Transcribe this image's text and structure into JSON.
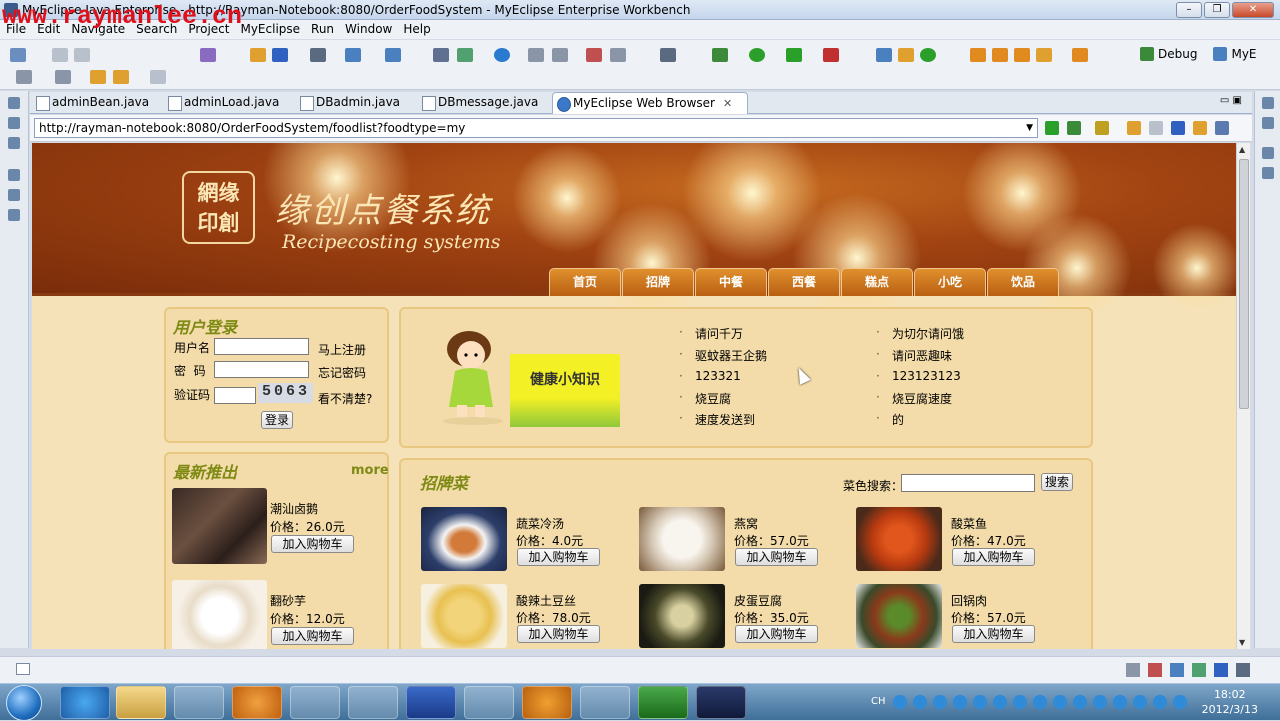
{
  "window": {
    "title": "MyEclipse Java Enterprise - http://Rayman-Notebook:8080/OrderFoodSystem - MyEclipse Enterprise Workbench",
    "watermark": "www.raymanlee.cn"
  },
  "menubar": [
    "File",
    "Edit",
    "Navigate",
    "Search",
    "Project",
    "MyEclipse",
    "Run",
    "Window",
    "Help"
  ],
  "toolbar": {
    "debug_label": "Debug",
    "perspective_label": "MyE"
  },
  "tabs": [
    {
      "label": "adminBean.java"
    },
    {
      "label": "adminLoad.java"
    },
    {
      "label": "DBadmin.java"
    },
    {
      "label": "DBmessage.java"
    },
    {
      "label": "MyEclipse Web Browser",
      "close": "✕"
    }
  ],
  "browser": {
    "url": "http://rayman-notebook:8080/OrderFoodSystem/foodlist?foodtype=my"
  },
  "site": {
    "logo_line1": "網缘",
    "logo_line2": "印創",
    "title": "缘创点餐系统",
    "subtitle": "Recipecosting systems",
    "nav": [
      "首页",
      "招牌",
      "中餐",
      "西餐",
      "糕点",
      "小吃",
      "饮品"
    ]
  },
  "login": {
    "title": "用户登录",
    "username_label": "用户名",
    "password_label": "密  码",
    "captcha_label": "验证码",
    "captcha_value": "5063",
    "register_link": "马上注册",
    "forgot_link": "忘记密码",
    "unclear_link": "看不清楚?",
    "submit": "登录"
  },
  "tips": {
    "banner_text": "健康小知识",
    "col1": [
      "请问千万",
      "驱蚊器王企鹅",
      "123321",
      "烧豆腐",
      "速度发送到"
    ],
    "col2": [
      "为切尔请问饿",
      "请问恶趣味",
      "123123123",
      "烧豆腐速度",
      "的"
    ]
  },
  "newest": {
    "title": "最新推出",
    "more": "more",
    "items": [
      {
        "name": "潮汕卤鹅",
        "price": "价格：26.0元",
        "button": "加入购物车"
      },
      {
        "name": "翻砂芋",
        "price": "价格：12.0元",
        "button": "加入购物车"
      }
    ]
  },
  "signature": {
    "title": "招牌菜",
    "search_label": "菜色搜索：",
    "search_button": "搜索",
    "items": [
      {
        "name": "蔬菜冷汤",
        "price": "价格：4.0元",
        "button": "加入购物车"
      },
      {
        "name": "燕窝",
        "price": "价格：57.0元",
        "button": "加入购物车"
      },
      {
        "name": "酸菜鱼",
        "price": "价格：47.0元",
        "button": "加入购物车"
      },
      {
        "name": "酸辣土豆丝",
        "price": "价格：78.0元",
        "button": "加入购物车"
      },
      {
        "name": "皮蛋豆腐",
        "price": "价格：35.0元",
        "button": "加入购物车"
      },
      {
        "name": "回锅肉",
        "price": "价格：57.0元",
        "button": "加入购物车"
      }
    ]
  },
  "taskbar": {
    "time": "18:02",
    "date": "2012/3/13",
    "lang": "CH"
  }
}
